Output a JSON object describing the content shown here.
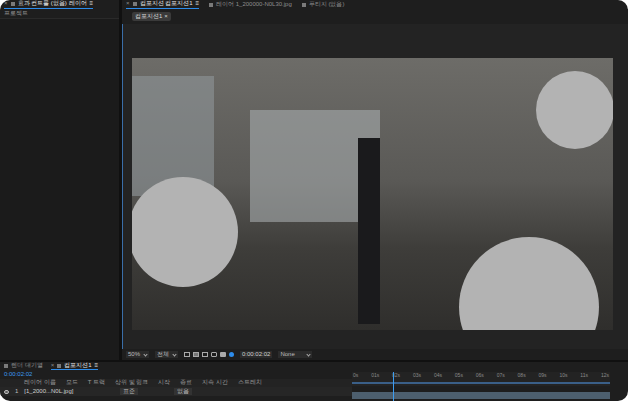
{
  "left_panel": {
    "tab": {
      "close": "×",
      "label": "효과 컨트롤 (없음) 레이어",
      "menu": "≡",
      "selected": true
    },
    "title": "프로젝트"
  },
  "viewer": {
    "tabs": [
      {
        "close": "×",
        "label": "컴포지션 컴포지션1",
        "menu": "≡",
        "selected": true
      },
      {
        "label": "레이어 1_200000-N0L30.jpg",
        "selected": false
      },
      {
        "label": "푸티지 (없음)",
        "selected": false
      }
    ],
    "comp_tab": {
      "label": "컴포지션1",
      "close": "×"
    }
  },
  "viewer_toolbar": {
    "zoom": "50%",
    "resolution": "전체",
    "time": "0:00:02:02",
    "renderer": "None"
  },
  "timeline": {
    "tabs": [
      {
        "label": "렌더 대기열",
        "selected": false
      },
      {
        "label": "컴포지션1",
        "close": "×",
        "menu": "≡",
        "selected": true
      }
    ],
    "time": "0:00:02:02",
    "columns": [
      "레이어 이름",
      "모드",
      "T 트랙",
      "상위 및 링크",
      "시작",
      "종료",
      "지속 시간",
      "스트레치"
    ],
    "layers": [
      {
        "number": "1",
        "name": "[1_2000...N0L.jpg]",
        "mode": "표준",
        "parent": "없음",
        "visible": true
      }
    ],
    "ruler": [
      "0s",
      "01s",
      "02s",
      "03s",
      "04s",
      "05s",
      "06s",
      "07s",
      "08s",
      "09s",
      "10s",
      "11s",
      "12s"
    ],
    "playhead": 0.16
  }
}
